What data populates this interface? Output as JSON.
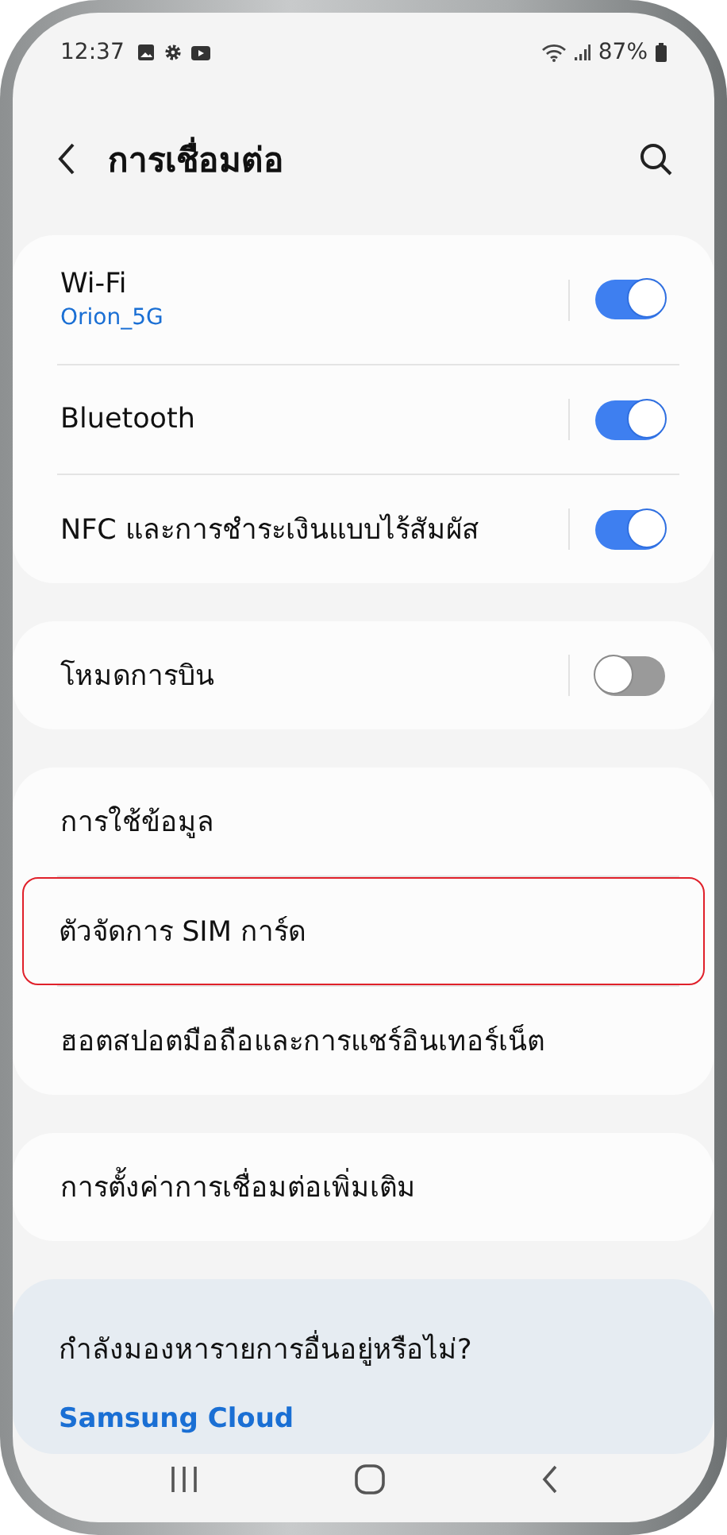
{
  "status_bar": {
    "time": "12:37",
    "battery": "87%"
  },
  "header": {
    "title": "การเชื่อมต่อ"
  },
  "groups": [
    {
      "items": [
        {
          "kind": "toggle",
          "label": "Wi-Fi",
          "subtitle": "Orion_5G",
          "on": true,
          "highlighted": false
        },
        {
          "kind": "toggle",
          "label": "Bluetooth",
          "on": true,
          "highlighted": false
        },
        {
          "kind": "toggle",
          "label": "NFC และการชำระเงินแบบไร้สัมผัส",
          "on": true,
          "highlighted": false
        }
      ]
    },
    {
      "items": [
        {
          "kind": "toggle",
          "label": "โหมดการบิน",
          "on": false,
          "highlighted": false
        }
      ]
    },
    {
      "items": [
        {
          "kind": "link",
          "label": "การใช้ข้อมูล",
          "highlighted": false
        },
        {
          "kind": "link",
          "label": "ตัวจัดการ SIM การ์ด",
          "highlighted": true
        },
        {
          "kind": "link",
          "label": "ฮอตสปอตมือถือและการแชร์อินเทอร์เน็ต",
          "highlighted": false
        }
      ]
    },
    {
      "items": [
        {
          "kind": "link",
          "label": "การตั้งค่าการเชื่อมต่อเพิ่มเติม",
          "highlighted": false
        }
      ]
    }
  ],
  "suggestion": {
    "question": "กำลังมองหารายการอื่นอยู่หรือไม่?",
    "link": "Samsung Cloud"
  }
}
